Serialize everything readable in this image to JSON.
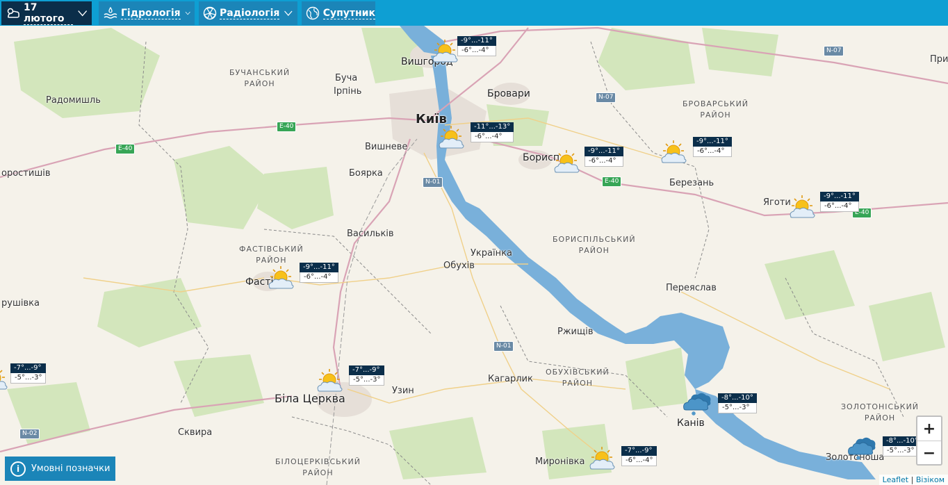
{
  "toolbar": {
    "date_label": "17 лютого",
    "hydrology_label": "Гідрологія",
    "radiology_label": "Радіологія",
    "satellite_label": "Супутник"
  },
  "places": [
    {
      "id": "kyiv",
      "label": "Київ"
    },
    {
      "id": "vyshhorod",
      "label": "Вишгород"
    },
    {
      "id": "bucha",
      "label": "Буча"
    },
    {
      "id": "irpin",
      "label": "Ірпінь"
    },
    {
      "id": "brovary",
      "label": "Бровари"
    },
    {
      "id": "radomyshl",
      "label": "Радомишль"
    },
    {
      "id": "vyshneve",
      "label": "Вишневе"
    },
    {
      "id": "boryspil",
      "label": "Борисп"
    },
    {
      "id": "boiarka",
      "label": "Боярка"
    },
    {
      "id": "berezan",
      "label": "Березань"
    },
    {
      "id": "yahotyn",
      "label": "Яготи"
    },
    {
      "id": "korostyshiv",
      "label": "оростишів"
    },
    {
      "id": "vasylkiv",
      "label": "Васильків"
    },
    {
      "id": "ukrainka",
      "label": "Українка"
    },
    {
      "id": "obukhiv",
      "label": "Обухів"
    },
    {
      "id": "fastiv",
      "label": "Фасті"
    },
    {
      "id": "pereiaslav",
      "label": "Переяслав"
    },
    {
      "id": "druzhivka",
      "label": "рушівка"
    },
    {
      "id": "rzhyshchiv",
      "label": "Ржищів"
    },
    {
      "id": "bila_tserkva",
      "label": "Біла Церква"
    },
    {
      "id": "kaharlyk",
      "label": "Кагарлик"
    },
    {
      "id": "uzyn",
      "label": "Узин"
    },
    {
      "id": "kaniv",
      "label": "Канів"
    },
    {
      "id": "skvyra",
      "label": "Сквира"
    },
    {
      "id": "myronivka",
      "label": "Миронівка"
    },
    {
      "id": "zolotonosha",
      "label": "Золотоноша"
    },
    {
      "id": "pry",
      "label": "При"
    }
  ],
  "districts": [
    {
      "id": "buchanskyi",
      "line1": "БУЧАНСЬКИЙ",
      "line2": "РАЙОН"
    },
    {
      "id": "brovarskyi",
      "line1": "БРОВАРСЬКИЙ",
      "line2": "РАЙОН"
    },
    {
      "id": "boryspilskyi",
      "line1": "БОРИСПІЛЬСЬКИЙ",
      "line2": "РАЙОН"
    },
    {
      "id": "fastivskyi",
      "line1": "ФАСТІВСЬКИЙ",
      "line2": "РАЙОН"
    },
    {
      "id": "obukhivskyi",
      "line1": "ОБУХІВСЬКИЙ",
      "line2": "РАЙОН"
    },
    {
      "id": "zolotoniskyi",
      "line1": "ЗОЛОТОНІСЬКИЙ",
      "line2": "РАЙОН"
    },
    {
      "id": "bilotserkivskyi",
      "line1": "БІЛОЦЕРКІВСЬКИЙ",
      "line2": "РАЙОН"
    }
  ],
  "roads": [
    {
      "id": "e40a",
      "label": "E-40"
    },
    {
      "id": "e40b",
      "label": "E-40"
    },
    {
      "id": "e40c",
      "label": "E-40"
    },
    {
      "id": "e40d",
      "label": "E-40"
    },
    {
      "id": "n07a",
      "label": "N-07"
    },
    {
      "id": "n07b",
      "label": "N-07"
    },
    {
      "id": "n01a",
      "label": "N-01"
    },
    {
      "id": "n01b",
      "label": "N-01"
    },
    {
      "id": "n02",
      "label": "N-02"
    }
  ],
  "weather": [
    {
      "id": "vyshhorod",
      "day": "-9°...-11°",
      "night": "-6°...-4°",
      "icon": "sun-cloud-icon"
    },
    {
      "id": "kyiv",
      "day": "-11°...-13°",
      "night": "-6°...-4°",
      "icon": "sun-cloud-icon"
    },
    {
      "id": "boryspil",
      "day": "-9°...-11°",
      "night": "-6°...-4°",
      "icon": "sun-cloud-icon"
    },
    {
      "id": "brovarskyi",
      "day": "-9°...-11°",
      "night": "-6°...-4°",
      "icon": "sun-cloud-icon"
    },
    {
      "id": "yahotyn",
      "day": "-9°...-11°",
      "night": "-6°...-4°",
      "icon": "sun-cloud-icon"
    },
    {
      "id": "fastiv",
      "day": "-9°...-11°",
      "night": "-6°...-4°",
      "icon": "sun-cloud-icon"
    },
    {
      "id": "west",
      "day": "-7°...-9°",
      "night": "-5°...-3°",
      "icon": "sun-cloud-icon"
    },
    {
      "id": "bila_tserkva",
      "day": "-7°...-9°",
      "night": "-5°...-3°",
      "icon": "sun-cloud-icon"
    },
    {
      "id": "kaniv",
      "day": "-8°...-10°",
      "night": "-5°...-3°",
      "icon": "snow-cloud-icon"
    },
    {
      "id": "zolotonosha",
      "day": "-8°...-10°",
      "night": "-5°...-3°",
      "icon": "snow-cloud-icon"
    },
    {
      "id": "myronivka",
      "day": "-7°...-9°",
      "night": "-6°...-4°",
      "icon": "sun-cloud-icon"
    }
  ],
  "controls": {
    "zoom_in": "+",
    "zoom_out": "−",
    "legend_label": "Умовні позначки",
    "legend_icon": "i"
  },
  "attribution": {
    "leaflet": "Leaflet",
    "sep": " | ",
    "provider": "Візіком"
  },
  "colors": {
    "water": "#6fa8d6",
    "forest": "#cfe3b5",
    "topbar": "#0e9fd3",
    "active_tab": "#0b2e4a"
  }
}
